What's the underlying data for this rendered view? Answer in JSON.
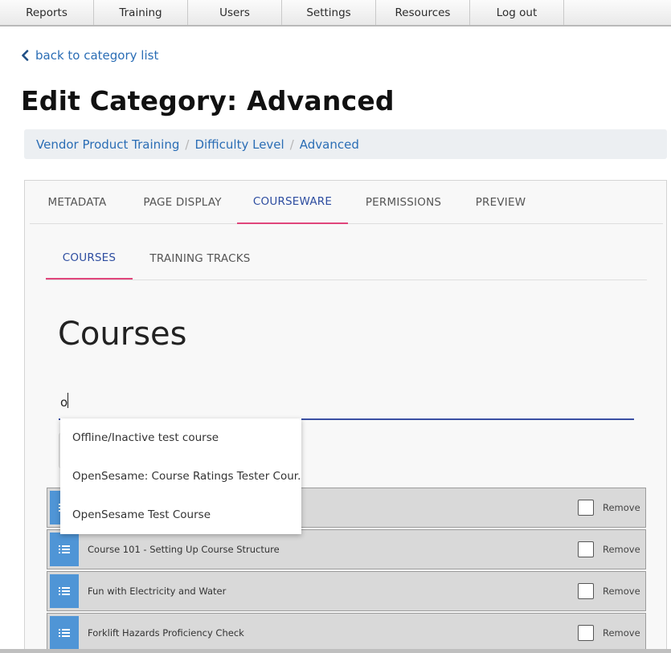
{
  "nav": {
    "items": [
      "Reports",
      "Training",
      "Users",
      "Settings",
      "Resources",
      "Log out"
    ]
  },
  "back_link": {
    "label": "back to category list",
    "icon": "chevron-left-icon"
  },
  "page_title": "Edit Category: Advanced",
  "breadcrumb": [
    "Vendor Product Training",
    "Difficulty Level",
    "Advanced"
  ],
  "tabs": {
    "items": [
      "METADATA",
      "PAGE DISPLAY",
      "COURSEWARE",
      "PERMISSIONS",
      "PREVIEW"
    ],
    "active": "COURSEWARE"
  },
  "subtabs": {
    "items": [
      "COURSES",
      "TRAINING TRACKS"
    ],
    "active": "COURSES"
  },
  "courses_section": {
    "heading": "Courses",
    "search_value": "o",
    "autocomplete": [
      "Offline/Inactive test course",
      "OpenSesame: Course Ratings Tester Cour...",
      "OpenSesame Test Course"
    ],
    "remove_label": "Remove",
    "rows": [
      "",
      "Course 101 - Setting Up Course Structure",
      "Fun with Electricity and Water",
      "Forklift Hazards Proficiency Check"
    ]
  },
  "colors": {
    "accent_blue": "#2d4da0",
    "link_blue": "#2a6db5",
    "tab_indicator": "#e0457b",
    "handle_blue": "#4f95d6"
  }
}
